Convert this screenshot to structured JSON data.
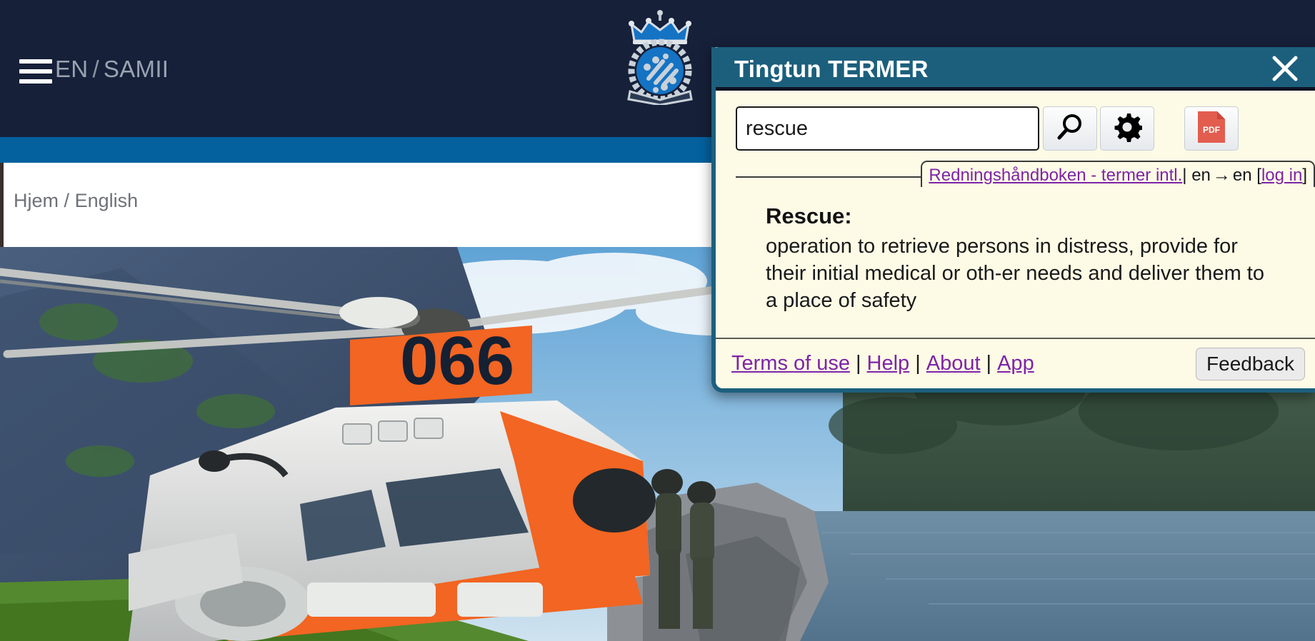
{
  "site": {
    "header": {
      "menu_icon": "hamburger-menu-icon",
      "lang_en": "EN",
      "lang_separator": "/",
      "lang_sami": "SAMII",
      "logo_icon": "royal-crest-logo"
    },
    "breadcrumb": {
      "home": "Hjem",
      "separator": "/",
      "current": "English"
    },
    "hero_photo": {
      "alt": "Sea King rescue helicopter 066 on a fjord shoreline with two crew members",
      "tail_number": "066"
    }
  },
  "termer": {
    "title": "Tingtun TERMER",
    "close_icon": "close-x-icon",
    "search": {
      "value": "rescue",
      "placeholder": "",
      "search_icon": "magnifier-icon",
      "settings_icon": "gear-icon",
      "pdf_icon": "pdf-file-icon",
      "pdf_label": "PDF"
    },
    "source": {
      "collection_link": "Redningshåndboken - termer intl.",
      "bar": "|",
      "lang_from": "en",
      "arrow": "→",
      "lang_to": "en",
      "login_open": "[",
      "login_link": "log in",
      "login_close": "]"
    },
    "entry": {
      "term": "Rescue:",
      "definition": "operation to retrieve persons in distress, provide for their initial medical or oth-er needs and deliver them to a place of safety"
    },
    "footer": {
      "terms": "Terms of use",
      "help": "Help",
      "about": "About",
      "app": "App",
      "divider": "|",
      "feedback": "Feedback"
    }
  },
  "colors": {
    "header_navy": "#162039",
    "band_blue": "#04619e",
    "dialog_teal": "#1c5f7d",
    "dialog_cream": "#fdfbe6",
    "link_purple": "#7d24a8",
    "pdf_red": "#e35d4f"
  }
}
